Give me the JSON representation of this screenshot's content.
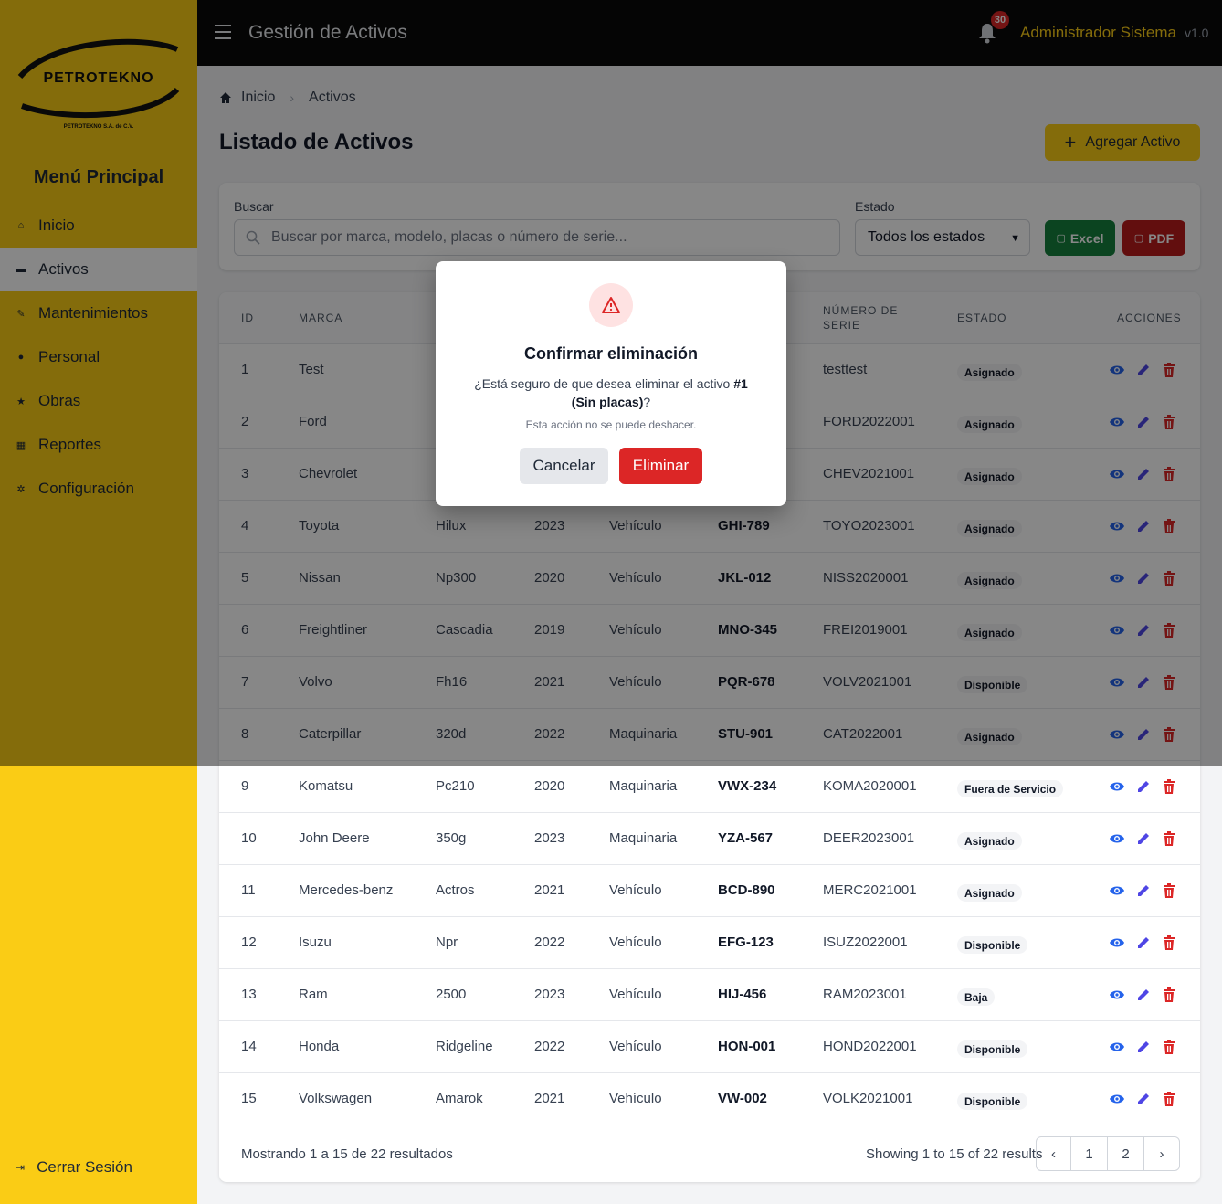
{
  "sidebar": {
    "logo_text": "PETROTEKNO",
    "logo_subtext": "PETROTEKNO S.A. de C.V.",
    "menu_title": "Menú Principal",
    "items": [
      {
        "label": "Inicio",
        "icon": "home-icon"
      },
      {
        "label": "Activos",
        "icon": "car-icon"
      },
      {
        "label": "Mantenimientos",
        "icon": "wrench-icon"
      },
      {
        "label": "Personal",
        "icon": "user-icon"
      },
      {
        "label": "Obras",
        "icon": "star-icon"
      },
      {
        "label": "Reportes",
        "icon": "report-icon"
      },
      {
        "label": "Configuración",
        "icon": "gear-icon"
      }
    ],
    "active_item": "Activos",
    "logout_label": "Cerrar Sesión"
  },
  "topbar": {
    "title": "Gestión de Activos",
    "notification_count": "30",
    "user_name": "Administrador Sistema",
    "version": "v1.0"
  },
  "breadcrumb": {
    "home": "Inicio",
    "current": "Activos"
  },
  "page": {
    "title": "Listado de Activos",
    "add_button": "Agregar Activo"
  },
  "filters": {
    "search_label": "Buscar",
    "search_placeholder": "Buscar por marca, modelo, placas o número de serie...",
    "status_label": "Estado",
    "status_value": "Todos los estados",
    "excel_button": "Excel",
    "pdf_button": "PDF"
  },
  "table": {
    "headers": {
      "id": "ID",
      "marca": "MARCA",
      "serie": "NÚMERO DE SERIE",
      "estado": "ESTADO",
      "acciones": "ACCIONES"
    },
    "rows": [
      {
        "id": "1",
        "marca": "Test",
        "modelo": "",
        "anio": "",
        "tipo": "",
        "placas": "",
        "serie": "testtest",
        "estado": "Asignado"
      },
      {
        "id": "2",
        "marca": "Ford",
        "modelo": "",
        "anio": "",
        "tipo": "",
        "placas": "",
        "serie": "FORD2022001",
        "estado": "Asignado"
      },
      {
        "id": "3",
        "marca": "Chevrolet",
        "modelo": "",
        "anio": "",
        "tipo": "",
        "placas": "",
        "serie": "CHEV2021001",
        "estado": "Asignado"
      },
      {
        "id": "4",
        "marca": "Toyota",
        "modelo": "Hilux",
        "anio": "2023",
        "tipo": "Vehículo",
        "placas": "GHI-789",
        "serie": "TOYO2023001",
        "estado": "Asignado"
      },
      {
        "id": "5",
        "marca": "Nissan",
        "modelo": "Np300",
        "anio": "2020",
        "tipo": "Vehículo",
        "placas": "JKL-012",
        "serie": "NISS2020001",
        "estado": "Asignado"
      },
      {
        "id": "6",
        "marca": "Freightliner",
        "modelo": "Cascadia",
        "anio": "2019",
        "tipo": "Vehículo",
        "placas": "MNO-345",
        "serie": "FREI2019001",
        "estado": "Asignado"
      },
      {
        "id": "7",
        "marca": "Volvo",
        "modelo": "Fh16",
        "anio": "2021",
        "tipo": "Vehículo",
        "placas": "PQR-678",
        "serie": "VOLV2021001",
        "estado": "Disponible"
      },
      {
        "id": "8",
        "marca": "Caterpillar",
        "modelo": "320d",
        "anio": "2022",
        "tipo": "Maquinaria",
        "placas": "STU-901",
        "serie": "CAT2022001",
        "estado": "Asignado"
      },
      {
        "id": "9",
        "marca": "Komatsu",
        "modelo": "Pc210",
        "anio": "2020",
        "tipo": "Maquinaria",
        "placas": "VWX-234",
        "serie": "KOMA2020001",
        "estado": "Fuera de Servicio"
      },
      {
        "id": "10",
        "marca": "John Deere",
        "modelo": "350g",
        "anio": "2023",
        "tipo": "Maquinaria",
        "placas": "YZA-567",
        "serie": "DEER2023001",
        "estado": "Asignado"
      },
      {
        "id": "11",
        "marca": "Mercedes-benz",
        "modelo": "Actros",
        "anio": "2021",
        "tipo": "Vehículo",
        "placas": "BCD-890",
        "serie": "MERC2021001",
        "estado": "Asignado"
      },
      {
        "id": "12",
        "marca": "Isuzu",
        "modelo": "Npr",
        "anio": "2022",
        "tipo": "Vehículo",
        "placas": "EFG-123",
        "serie": "ISUZ2022001",
        "estado": "Disponible"
      },
      {
        "id": "13",
        "marca": "Ram",
        "modelo": "2500",
        "anio": "2023",
        "tipo": "Vehículo",
        "placas": "HIJ-456",
        "serie": "RAM2023001",
        "estado": "Baja"
      },
      {
        "id": "14",
        "marca": "Honda",
        "modelo": "Ridgeline",
        "anio": "2022",
        "tipo": "Vehículo",
        "placas": "HON-001",
        "serie": "HOND2022001",
        "estado": "Disponible"
      },
      {
        "id": "15",
        "marca": "Volkswagen",
        "modelo": "Amarok",
        "anio": "2021",
        "tipo": "Vehículo",
        "placas": "VW-002",
        "serie": "VOLK2021001",
        "estado": "Disponible"
      }
    ],
    "footer_left": "Mostrando 1 a 15 de 22 resultados",
    "footer_right": "Showing 1 to 15 of 22 results",
    "pages": [
      "1",
      "2"
    ]
  },
  "modal": {
    "title": "Confirmar eliminación",
    "message_prefix": "¿Está seguro de que desea eliminar el activo ",
    "message_bold": "#1 (Sin placas)",
    "message_suffix": "?",
    "note": "Esta acción no se puede deshacer.",
    "cancel_button": "Cancelar",
    "delete_button": "Eliminar"
  },
  "colors": {
    "brand_yellow": "#facc15",
    "topbar_bg": "#0b0b0b",
    "excel_green": "#15803d",
    "pdf_red": "#b91c1c",
    "danger": "#dc2626",
    "view_icon": "#2563eb",
    "edit_icon": "#4f46e5"
  }
}
